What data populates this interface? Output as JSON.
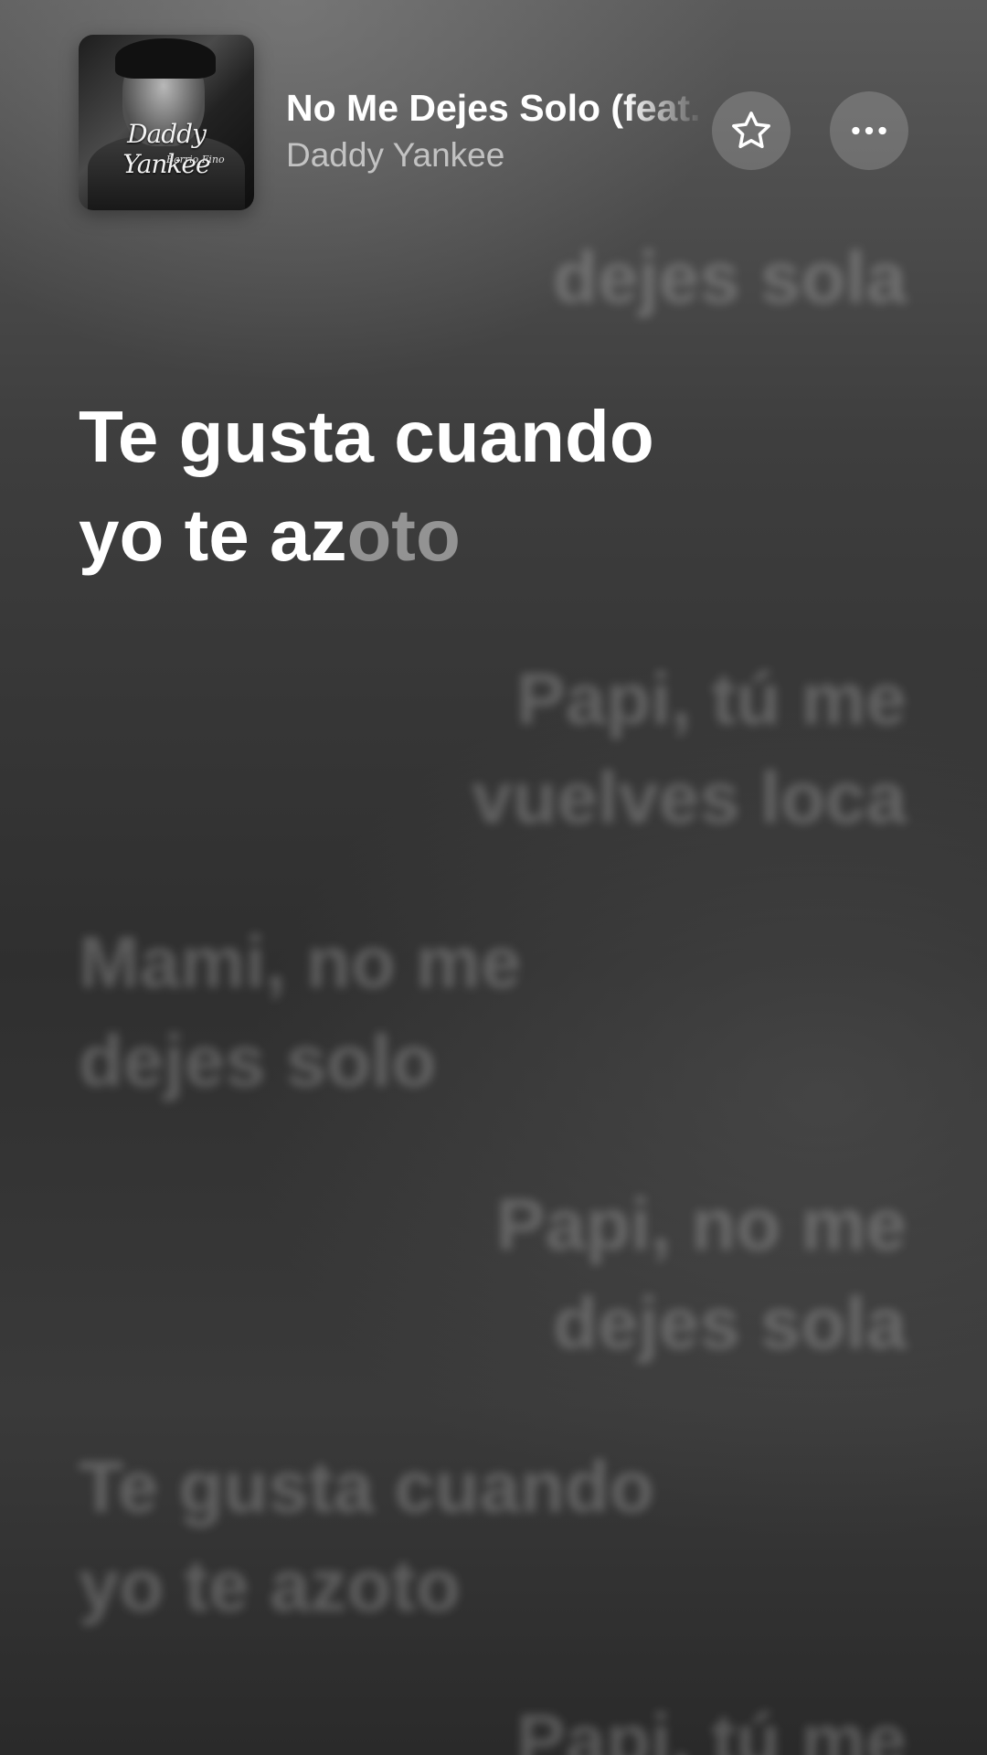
{
  "now_playing": {
    "title": "No Me Dejes Solo (feat. Wisin & Yandel)",
    "artist": "Daddy Yankee",
    "artwork_text": "Daddy Yankee",
    "artwork_subtext": "Barrio Fino"
  },
  "controls": {
    "favorite_icon": "star-icon",
    "more_icon": "ellipsis-icon"
  },
  "lyrics": {
    "prev": "dejes sola",
    "active_sung": "Te gusta cuando yo te az",
    "active_unsung": "oto",
    "next1": "Papi, tú me vuelves loca",
    "next2": "Mami, no me dejes solo",
    "next3": "Papi, no me dejes sola",
    "next4": "Te gusta cuando yo te azoto",
    "next5": "Papi, tú me"
  }
}
